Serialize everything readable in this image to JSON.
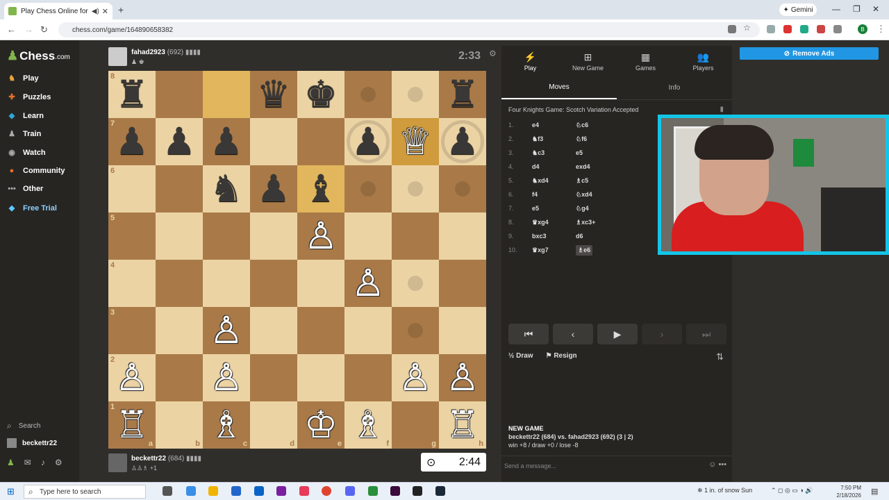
{
  "browser": {
    "tab_title": "Play Chess Online for FREE",
    "new_tab": "+",
    "gemini": "Gemini",
    "url": "chess.com/game/164890658382",
    "profile_initial": "B"
  },
  "sidebar": {
    "logo": "Chess",
    "logo_suffix": ".com",
    "items": [
      {
        "label": "Play",
        "icon": "play-icon"
      },
      {
        "label": "Puzzles",
        "icon": "puzzle-icon"
      },
      {
        "label": "Learn",
        "icon": "learn-icon"
      },
      {
        "label": "Train",
        "icon": "train-icon"
      },
      {
        "label": "Watch",
        "icon": "watch-icon"
      },
      {
        "label": "Community",
        "icon": "community-icon"
      },
      {
        "label": "Other",
        "icon": "more-icon"
      },
      {
        "label": "Free Trial",
        "icon": "diamond-icon"
      }
    ],
    "search": "Search",
    "user": "beckettr22"
  },
  "top_player": {
    "name": "fahad2923",
    "rating": "(692)",
    "clock": "2:33"
  },
  "bottom_player": {
    "name": "beckettr22",
    "rating": "(684)",
    "captured": "+1",
    "clock": "2:44"
  },
  "board": {
    "ranks": [
      "8",
      "7",
      "6",
      "5",
      "4",
      "3",
      "2",
      "1"
    ],
    "files": [
      "a",
      "b",
      "c",
      "d",
      "e",
      "f",
      "g",
      "h"
    ],
    "rows": [
      [
        "br",
        "",
        "",
        "bq",
        "bk",
        "",
        "",
        "br"
      ],
      [
        "bp",
        "bp",
        "bp",
        "",
        "",
        "bp",
        "wq",
        "bp"
      ],
      [
        "",
        "",
        "bn",
        "bp",
        "bb",
        "",
        "",
        ""
      ],
      [
        "",
        "",
        "",
        "",
        "wp",
        "",
        "",
        ""
      ],
      [
        "",
        "",
        "",
        "",
        "",
        "wp",
        "",
        ""
      ],
      [
        "",
        "",
        "wp",
        "",
        "",
        "",
        "",
        ""
      ],
      [
        "wp",
        "",
        "wp",
        "",
        "",
        "",
        "wp",
        "wp"
      ],
      [
        "wr",
        "",
        "wb",
        "",
        "wk",
        "wb",
        "",
        "wr"
      ]
    ]
  },
  "panel": {
    "tabs": [
      {
        "label": "Play",
        "icon": "bolt-icon"
      },
      {
        "label": "New Game",
        "icon": "plus-icon"
      },
      {
        "label": "Games",
        "icon": "grid-icon"
      },
      {
        "label": "Players",
        "icon": "players-icon"
      }
    ],
    "subtabs": [
      "Moves",
      "Info"
    ],
    "opening": "Four Knights Game: Scotch Variation Accepted",
    "moves": [
      {
        "n": "1.",
        "w": "e4",
        "b": "♘c6"
      },
      {
        "n": "2.",
        "w": "♞f3",
        "b": "♘f6"
      },
      {
        "n": "3.",
        "w": "♞c3",
        "b": "e5"
      },
      {
        "n": "4.",
        "w": "d4",
        "b": "exd4"
      },
      {
        "n": "5.",
        "w": "♞xd4",
        "b": "♗c5"
      },
      {
        "n": "6.",
        "w": "f4",
        "b": "♘xd4"
      },
      {
        "n": "7.",
        "w": "e5",
        "b": "♘g4"
      },
      {
        "n": "8.",
        "w": "♛xg4",
        "b": "♗xc3+"
      },
      {
        "n": "9.",
        "w": "bxc3",
        "b": "d6"
      },
      {
        "n": "10.",
        "w": "♛xg7",
        "b": "♗e6"
      }
    ],
    "draw": "Draw",
    "resign": "Resign",
    "new_game_title": "NEW GAME",
    "new_game_vs": "beckettr22 (684) vs. fahad2923 (692) (3 | 2)",
    "new_game_stats": "win +8 / draw +0 / lose -8",
    "message_placeholder": "Send a message..."
  },
  "ads": {
    "remove": "Remove Ads"
  },
  "taskbar": {
    "search": "Type here to search",
    "weather": "1 in. of snow Sun",
    "time": "7:50 PM",
    "date": "2/18/2026"
  }
}
